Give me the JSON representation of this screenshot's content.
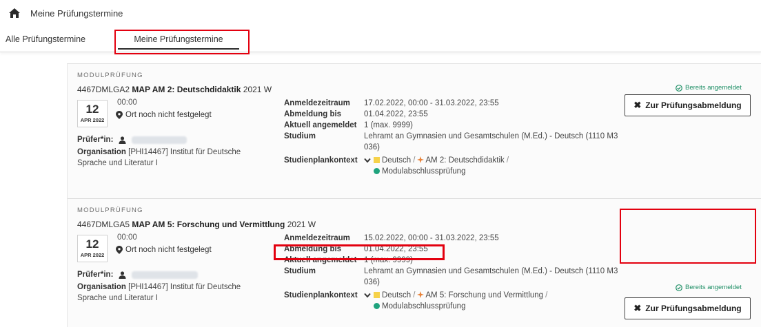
{
  "breadcrumb": {
    "icon": "home-icon",
    "label": "Meine Prüfungstermine"
  },
  "tabs": [
    {
      "label": "Alle Prüfungstermine",
      "active": false
    },
    {
      "label": "Meine Prüfungstermine",
      "active": true
    }
  ],
  "colors": {
    "highlight": "#e3000f",
    "status_green": "#1f8f66",
    "tag_yellow": "#f6d24a",
    "tag_orange": "#e8833a",
    "tag_teal": "#1fa37d"
  },
  "labels": {
    "anmeldezeitraum": "Anmeldezeitraum",
    "abmeldung_bis": "Abmeldung bis",
    "aktuell": "Aktuell angemeldet",
    "studium": "Studium",
    "studienplankontext": "Studienplankontext",
    "pruefer": "Prüfer*in:",
    "organisation": "Organisation"
  },
  "exams": [
    {
      "type": "MODULPRÜFUNG",
      "code": "4467DMLGA2",
      "title": "MAP AM 2: Deutschdidaktik",
      "semester": "2021 W",
      "day": "12",
      "month": "APR 2022",
      "time": "00:00",
      "location": "Ort noch nicht festgelegt",
      "organisation": "[PHI14467] Institut für Deutsche Sprache und Literatur I",
      "anmeldezeitraum": "17.02.2022, 00:00 - 31.03.2022, 23:55",
      "abmeldung_bis": "01.04.2022, 23:55",
      "aktuell": "1 (max. 9999)",
      "studium": "Lehramt an Gymnasien und Gesamtschulen (M.Ed.) - Deutsch (1110 M3 036)",
      "kontext": {
        "fach": "Deutsch",
        "modul": "AM 2: Deutschdidaktik",
        "pruefung": "Modulabschlussprüfung",
        "sep": "/"
      },
      "status": "Bereits angemeldet",
      "button": "Zur Prüfungsabmeldung"
    },
    {
      "type": "MODULPRÜFUNG",
      "code": "4467DMLGA5",
      "title": "MAP AM 5: Forschung und Vermittlung",
      "semester": "2021 W",
      "day": "12",
      "month": "APR 2022",
      "time": "00:00",
      "location": "Ort noch nicht festgelegt",
      "organisation": "[PHI14467] Institut für Deutsche Sprache und Literatur I",
      "anmeldezeitraum": "15.02.2022, 00:00 - 31.03.2022, 23:55",
      "abmeldung_bis": "01.04.2022, 23:55",
      "aktuell": "1 (max. 9999)",
      "studium": "Lehramt an Gymnasien und Gesamtschulen (M.Ed.) - Deutsch (1110 M3 036)",
      "kontext": {
        "fach": "Deutsch",
        "modul": "AM 5: Forschung und Vermittlung",
        "pruefung": "Modulabschlussprüfung",
        "sep": "/"
      },
      "status": "Bereits angemeldet",
      "button": "Zur Prüfungsabmeldung"
    }
  ]
}
